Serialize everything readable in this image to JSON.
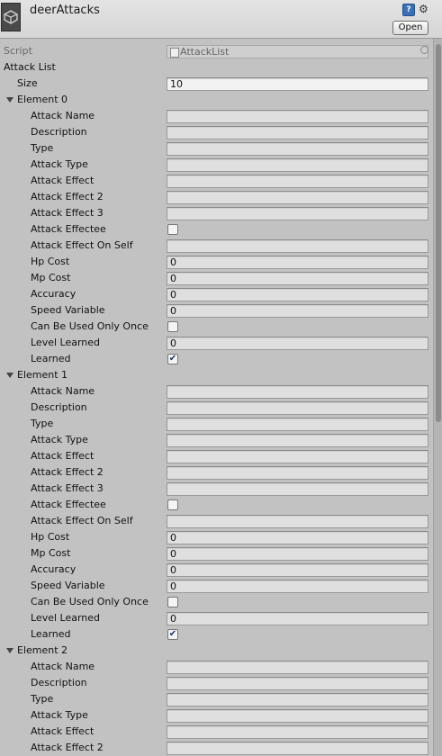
{
  "header": {
    "title": "deerAttacks",
    "open_label": "Open",
    "help_icon": "?",
    "gear_icon": "⚙"
  },
  "script_row": {
    "label": "Script",
    "value": "AttackList"
  },
  "attack_list": {
    "label": "Attack List",
    "size_label": "Size",
    "size_value": "10"
  },
  "field_labels": {
    "attack_name": "Attack Name",
    "description": "Description",
    "type": "Type",
    "attack_type": "Attack Type",
    "attack_effect": "Attack Effect",
    "attack_effect_2": "Attack Effect 2",
    "attack_effect_3": "Attack Effect 3",
    "attack_effectee": "Attack Effectee",
    "attack_effect_on_self": "Attack Effect On Self",
    "hp_cost": "Hp Cost",
    "mp_cost": "Mp Cost",
    "accuracy": "Accuracy",
    "speed_variable": "Speed Variable",
    "can_be_used_only_once": "Can Be Used Only Once",
    "level_learned": "Level Learned",
    "learned": "Learned"
  },
  "elements": [
    {
      "label": "Element 0",
      "attack_name": "",
      "description": "",
      "type": "",
      "attack_type": "",
      "attack_effect": "",
      "attack_effect_2": "",
      "attack_effect_3": "",
      "attack_effectee": false,
      "attack_effect_on_self": "",
      "hp_cost": "0",
      "mp_cost": "0",
      "accuracy": "0",
      "speed_variable": "0",
      "can_be_used_only_once": false,
      "level_learned": "0",
      "learned": true
    },
    {
      "label": "Element 1",
      "attack_name": "",
      "description": "",
      "type": "",
      "attack_type": "",
      "attack_effect": "",
      "attack_effect_2": "",
      "attack_effect_3": "",
      "attack_effectee": false,
      "attack_effect_on_self": "",
      "hp_cost": "0",
      "mp_cost": "0",
      "accuracy": "0",
      "speed_variable": "0",
      "can_be_used_only_once": false,
      "level_learned": "0",
      "learned": true
    },
    {
      "label": "Element 2",
      "attack_name": "",
      "description": "",
      "type": "",
      "attack_type": "",
      "attack_effect": "",
      "attack_effect_2": ""
    }
  ]
}
